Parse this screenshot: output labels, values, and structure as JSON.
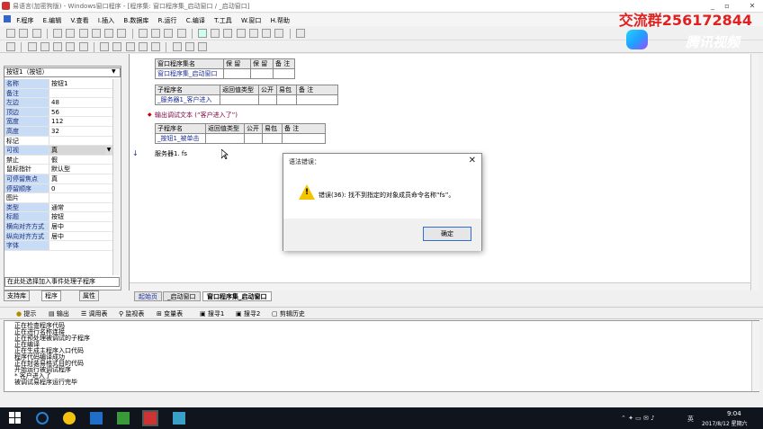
{
  "window": {
    "title": "易语言(加密狗版) - Windows窗口程序 - [程序集: 窗口程序集_启动窗口 / _启动窗口]",
    "controls": [
      "_",
      "▫",
      "✕"
    ]
  },
  "overlay": {
    "group_text": "交流群256172844",
    "brand_text": "腾讯视频"
  },
  "menu": [
    "F.程序",
    "E.编辑",
    "V.查看",
    "I.插入",
    "B.数据库",
    "R.运行",
    "C.编译",
    "T.工具",
    "W.窗口",
    "H.帮助"
  ],
  "left": {
    "component_selected": "按钮1（按钮）",
    "properties": [
      {
        "key": "名称",
        "value": "按钮1",
        "blue": true
      },
      {
        "key": "备注",
        "value": "",
        "blue": true
      },
      {
        "key": "左边",
        "value": "48",
        "blue": true
      },
      {
        "key": "顶边",
        "value": "56",
        "blue": true
      },
      {
        "key": "宽度",
        "value": "112",
        "blue": true
      },
      {
        "key": "高度",
        "value": "32",
        "blue": true
      },
      {
        "key": "标记",
        "value": "",
        "blue": false
      },
      {
        "key": "可视",
        "value": "真",
        "blue": true,
        "selected": true
      },
      {
        "key": "禁止",
        "value": "假",
        "blue": false
      },
      {
        "key": "鼠标指针",
        "value": "默认型",
        "blue": false
      },
      {
        "key": "可停留焦点",
        "value": "真",
        "blue": true
      },
      {
        "key": "  停留顺序",
        "value": "0",
        "blue": true
      },
      {
        "key": "图片",
        "value": "",
        "blue": false
      },
      {
        "key": "类型",
        "value": "通常",
        "blue": true
      },
      {
        "key": "标题",
        "value": "按钮",
        "blue": true
      },
      {
        "key": "横向对齐方式",
        "value": "居中",
        "blue": true
      },
      {
        "key": "纵向对齐方式",
        "value": "居中",
        "blue": true
      },
      {
        "key": "字体",
        "value": "",
        "blue": true
      }
    ],
    "event_combo": "在此处选择加入事件处理子程序",
    "tabs": [
      "支持库",
      "程序",
      "属性"
    ]
  },
  "editor": {
    "assembly_header": [
      "窗口程序集名",
      "保 留",
      "保 留",
      "备 注"
    ],
    "assembly_name": "窗口程序集_启动窗口",
    "sub1_header": [
      "子程序名",
      "返回值类型",
      "公开",
      "易包",
      "备 注"
    ],
    "sub1_name": "_服务器1_客户进入",
    "debug_line": "输出调试文本 (“客户进入了”)",
    "sub2_header": [
      "子程序名",
      "返回值类型",
      "公开",
      "易包",
      "备 注"
    ],
    "sub2_name": "_按钮1_被单击",
    "code_line": "服务器1. fs",
    "tabs": [
      "起始页",
      "_启动窗口",
      "窗口程序集_启动窗口"
    ]
  },
  "dialog": {
    "title": "语法错误：",
    "message": "错误(36): 找不到指定的对象成员命令名称“fs”。",
    "ok": "确定",
    "close": "✕"
  },
  "bottom_tabs": [
    "提示",
    "输出",
    "调用表",
    "监视表",
    "变量表",
    "搜寻1",
    "搜寻2",
    "剪辑历史"
  ],
  "output_lines": [
    "正在检查程序代码",
    "正在进行名称连接",
    "正在预处理被调试的子程序",
    "正在编译",
    "正在生成主程序入口代码",
    "程序代码编译成功",
    "正在封装易格式目的代码",
    "开始运行被调试程序",
    "* 客户进入了",
    "被调试易程序运行完毕"
  ],
  "taskbar": {
    "time": "9:04",
    "date": "2017/8/12 星期六",
    "lang": "英"
  },
  "colors": {
    "accent_blue": "#c9dcf5",
    "warning_yellow": "#f5c400",
    "overlay_red": "#e0201f"
  }
}
